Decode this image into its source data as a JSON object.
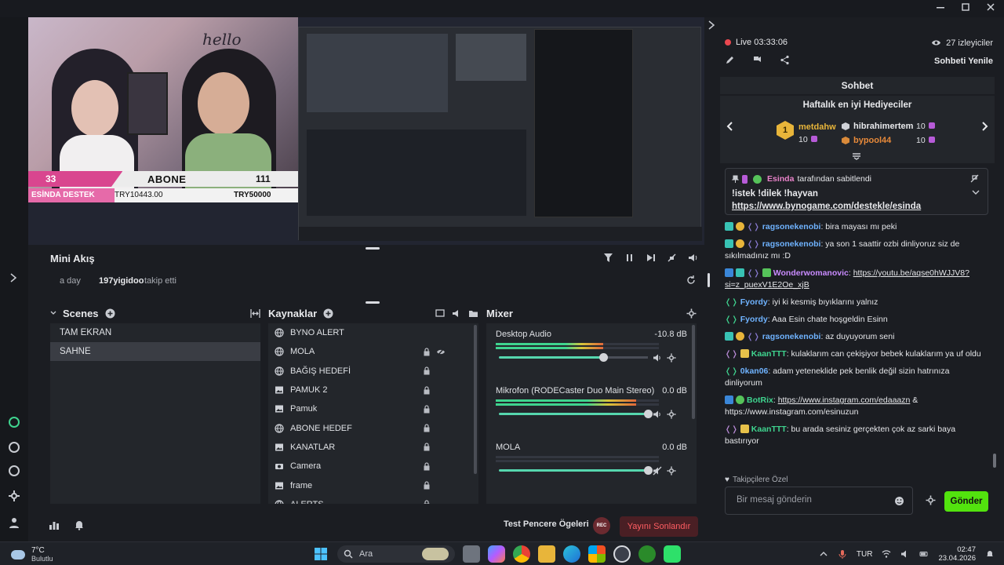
{
  "preview": {
    "hello_text": "hello",
    "goal": {
      "current": "33",
      "label": "ABONE",
      "target": "111",
      "progress": 0.297
    },
    "donation": {
      "label": "ESİNDA DESTEK",
      "current": "TRY10443.00",
      "target": "TRY50000",
      "progress": 0.209
    }
  },
  "mini_akis": {
    "title": "Mini Akış",
    "activity": {
      "time": "a day",
      "user": "197yigidoo",
      "action": "takip etti"
    }
  },
  "scenes": {
    "title": "Scenes",
    "items": [
      {
        "label": "TAM EKRAN",
        "active": false
      },
      {
        "label": "SAHNE",
        "active": true
      }
    ]
  },
  "sources": {
    "title": "Kaynaklar",
    "items": [
      {
        "label": "BYNO ALERT",
        "icon": "globe-icon"
      },
      {
        "label": "MOLA",
        "icon": "globe-icon"
      },
      {
        "label": "BAĞIŞ HEDEFİ",
        "icon": "globe-icon"
      },
      {
        "label": "PAMUK 2",
        "icon": "image-icon"
      },
      {
        "label": "Pamuk",
        "icon": "image-icon"
      },
      {
        "label": "ABONE HEDEF",
        "icon": "globe-icon"
      },
      {
        "label": "KANATLAR",
        "icon": "image-icon"
      },
      {
        "label": "Camera",
        "icon": "camera-icon"
      },
      {
        "label": "frame",
        "icon": "image-icon"
      },
      {
        "label": "ALERTS",
        "icon": "globe-icon"
      }
    ]
  },
  "mixer": {
    "title": "Mixer",
    "channels": [
      {
        "name": "Desktop Audio",
        "db": "-10.8 dB",
        "level": 0.66,
        "volume": 0.7,
        "muted": false
      },
      {
        "name": "Mikrofon (RODECaster Duo Main Stereo)",
        "db": "0.0 dB",
        "level": 0.86,
        "volume": 1.0,
        "muted": false
      },
      {
        "name": "MOLA",
        "db": "0.0 dB",
        "level": 0.0,
        "volume": 1.0,
        "muted": true
      }
    ]
  },
  "bottom": {
    "test_label": "Test Pencere Ögeleri",
    "rec_label": "REC",
    "end_label": "Yayını Sonlandır"
  },
  "chat": {
    "live_label": "Live 03:33:06",
    "viewers": "27 izleyiciler",
    "refresh_label": "Sohbeti Yenile",
    "title": "Sohbet",
    "gifters": {
      "title": "Haftalık en iyi Hediyeciler",
      "first": {
        "rank": "1",
        "name": "metdahw",
        "count": "10"
      },
      "second": {
        "name": "hibrahimertem",
        "count": "10"
      },
      "third": {
        "name": "bypool44",
        "count": "10"
      }
    },
    "pinned": {
      "by_user": "Esinda",
      "by_suffix": "tarafından sabitlendi",
      "message": "!istek !dilek !hayvan",
      "link": "https://www.bynogame.com/destekle/esinda"
    },
    "messages": [
      {
        "user": "ragsonekenobi",
        "color": "#6fb3ff",
        "text": ": bira mayası mı peki",
        "link": "",
        "text2": ""
      },
      {
        "user": "ragsonekenobi",
        "color": "#6fb3ff",
        "text": ": ya son 1 saattir ozbi dinliyoruz siz de sıkılmadınız mı :D",
        "link": "",
        "text2": ""
      },
      {
        "user": "Wonderwomanovic",
        "color": "#c98bff",
        "text": ": ",
        "link": "https://youtu.be/aqse0hWJJV8?si=z_puexV1E2Oe_xjB",
        "text2": ""
      },
      {
        "user": "Fyordy",
        "color": "#6fb3ff",
        "text": ": iyi ki kesmiş bıyıklarını yalnız",
        "link": "",
        "text2": ""
      },
      {
        "user": "Fyordy",
        "color": "#6fb3ff",
        "text": ": Aaa Esin chate hoşgeldin Esinn",
        "link": "",
        "text2": ""
      },
      {
        "user": "ragsonekenobi",
        "color": "#6fb3ff",
        "text": ": az duyuyorum seni",
        "link": "",
        "text2": ""
      },
      {
        "user": "KaanTTT",
        "color": "#3fd48f",
        "text": ": kulaklarım can çekişiyor bebek kulaklarım ya uf oldu",
        "link": "",
        "text2": ""
      },
      {
        "user": "0kan06",
        "color": "#6fb3ff",
        "text": ": adam yeteneklide pek benlik değil sizin hatrınıza dinliyorum",
        "link": "",
        "text2": ""
      },
      {
        "user": "BotRix",
        "color": "#3fd48f",
        "text": ": ",
        "link": "https://www.instagram.com/edaaazn",
        "text2": " & https://www.instagram.com/esinuzun"
      },
      {
        "user": "KaanTTT",
        "color": "#3fd48f",
        "text": ": bu arada sesiniz gerçekten çok az sarki baya bastırıyor",
        "link": "",
        "text2": ""
      }
    ],
    "follower_only": "Takipçilere Özel",
    "input_placeholder": "Bir mesaj gönderin",
    "send_label": "Gönder"
  },
  "taskbar": {
    "temperature": "7°C",
    "weather": "Bulutlu",
    "search_label": "Ara",
    "language": "TUR",
    "time": "02:47",
    "date": "23.04.2026"
  },
  "colors": {
    "accent_green": "#52e30e",
    "live_red": "#ea4850",
    "goal_pink": "#d9468f",
    "end_stream": "#ff5d62"
  }
}
